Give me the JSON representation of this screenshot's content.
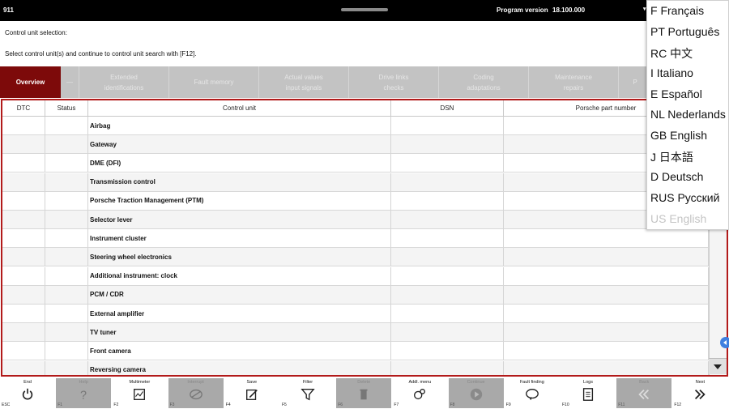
{
  "topbar": {
    "model": "911",
    "program_version_label": "Program version",
    "program_version": "18.100.000",
    "dropdown_arrow": "▾"
  },
  "info": {
    "line1": "Control unit selection:",
    "line2": "Select control unit(s) and continue to control unit search with [F12]."
  },
  "tabs": [
    {
      "label": "Overview",
      "active": true
    },
    {
      "label": "—",
      "active": false
    },
    {
      "label": "Extended\nidentifications",
      "active": false
    },
    {
      "label": "Fault memory",
      "active": false
    },
    {
      "label": "Actual values\ninput signals",
      "active": false
    },
    {
      "label": "Drive links\nchecks",
      "active": false
    },
    {
      "label": "Coding\nadaptations",
      "active": false
    },
    {
      "label": "Maintenance\nrepairs",
      "active": false
    },
    {
      "label": "P",
      "active": false
    }
  ],
  "table": {
    "columns": [
      "DTC",
      "Status",
      "Control unit",
      "DSN",
      "Porsche part number"
    ],
    "rows": [
      "Airbag",
      "Gateway",
      "DME (DFI)",
      "Transmission control",
      "Porsche Traction Management (PTM)",
      "Selector lever",
      "Instrument cluster",
      "Steering wheel electronics",
      "Additional instrument: clock",
      "PCM / CDR",
      "External amplifier",
      "TV tuner",
      "Front camera",
      "Reversing camera"
    ]
  },
  "language_menu": [
    {
      "label": "F Français",
      "disabled": false
    },
    {
      "label": "PT Português",
      "disabled": false
    },
    {
      "label": "RC 中文",
      "disabled": false
    },
    {
      "label": "I Italiano",
      "disabled": false
    },
    {
      "label": "E Español",
      "disabled": false
    },
    {
      "label": "NL Nederlands",
      "disabled": false
    },
    {
      "label": "GB English",
      "disabled": false
    },
    {
      "label": "J 日本語",
      "disabled": false
    },
    {
      "label": "D Deutsch",
      "disabled": false
    },
    {
      "label": "RUS Русский",
      "disabled": false
    },
    {
      "label": "US English",
      "disabled": true
    }
  ],
  "function_bar": [
    {
      "label": "End",
      "key": "ESC",
      "icon": "power-icon",
      "enabled": true
    },
    {
      "label": "Help",
      "key": "F1",
      "icon": "question-icon",
      "enabled": false
    },
    {
      "label": "Multimeter",
      "key": "F2",
      "icon": "multimeter-icon",
      "enabled": true
    },
    {
      "label": "Interrupt",
      "key": "F3",
      "icon": "interrupt-icon",
      "enabled": false
    },
    {
      "label": "Save",
      "key": "F4",
      "icon": "save-icon",
      "enabled": true
    },
    {
      "label": "Filter",
      "key": "F5",
      "icon": "filter-icon",
      "enabled": true
    },
    {
      "label": "Delete",
      "key": "F6",
      "icon": "delete-icon",
      "enabled": false
    },
    {
      "label": "Addl. menu",
      "key": "F7",
      "icon": "additional-menu-icon",
      "enabled": true
    },
    {
      "label": "Continue",
      "key": "F8",
      "icon": "play-icon",
      "enabled": false
    },
    {
      "label": "Fault finding",
      "key": "F9",
      "icon": "fault-finding-icon",
      "enabled": true
    },
    {
      "label": "Logs",
      "key": "F10",
      "icon": "logs-icon",
      "enabled": true
    },
    {
      "label": "Back",
      "key": "F11",
      "icon": "back-icon",
      "enabled": false
    },
    {
      "label": "Next",
      "key": "F12",
      "icon": "next-icon",
      "enabled": true
    }
  ],
  "colors": {
    "accent_red": "#7d0a0a",
    "frame_red": "#b21a1a",
    "disabled_gray": "#a9a9a9"
  }
}
